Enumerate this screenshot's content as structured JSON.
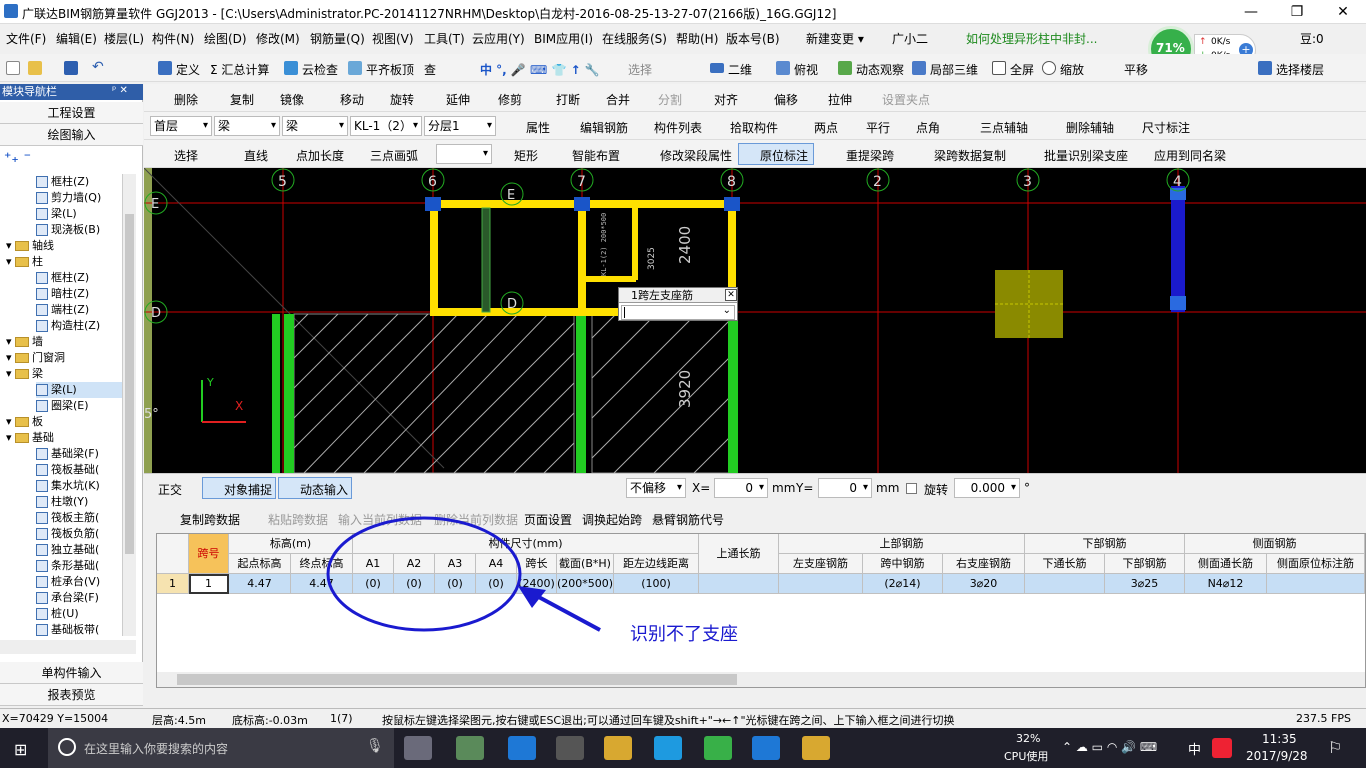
{
  "window": {
    "title": "广联达BIM钢筋算量软件 GGJ2013 - [C:\\Users\\Administrator.PC-20141127NRHM\\Desktop\\白龙村-2016-08-25-13-27-07(2166版)_16G.GGJ12]",
    "minimize": "—",
    "restore": "❐",
    "close": "✕"
  },
  "menu": [
    "文件(F)",
    "编辑(E)",
    "楼层(L)",
    "构件(N)",
    "绘图(D)",
    "修改(M)",
    "钢筋量(Q)",
    "视图(V)",
    "工具(T)",
    "云应用(Y)",
    "BIM应用(I)",
    "在线服务(S)",
    "帮助(H)",
    "版本号(B)",
    "新建变更 ▾",
    "广小二",
    "如何处理异形柱中非封...",
    "豆:0"
  ],
  "net": {
    "percent": "71%",
    "up": "0K/s",
    "down": "0K/s"
  },
  "toolbar1": [
    "定义",
    "Σ 汇总计算",
    "云检查",
    "平齐板顶",
    "查",
    "选择",
    "二维",
    "俯视",
    "动态观察",
    "局部三维",
    "全屏",
    "缩放",
    "平移",
    "",
    "选择楼层"
  ],
  "toolbar2": [
    "删除",
    "复制",
    "镜像",
    "移动",
    "旋转",
    "延伸",
    "修剪",
    "打断",
    "合并",
    "分割",
    "对齐",
    "偏移",
    "拉伸",
    "设置夹点"
  ],
  "toolbar3": {
    "floor": "首层",
    "type1": "梁",
    "type2": "梁",
    "name": "KL-1（2）",
    "layer": "分层1",
    "items": [
      "属性",
      "编辑钢筋",
      "构件列表",
      "拾取构件",
      "两点",
      "平行",
      "点角",
      "三点辅轴",
      "删除辅轴",
      "尺寸标注"
    ]
  },
  "toolbar4": [
    "选择",
    "直线",
    "点加长度",
    "三点画弧",
    "矩形",
    "智能布置",
    "修改梁段属性",
    "原位标注",
    "重提梁跨",
    "梁跨数据复制",
    "批量识别梁支座",
    "应用到同名梁"
  ],
  "sidebar": {
    "header": "模块导航栏",
    "pin": "ᵖ ✕",
    "tabs": [
      "工程设置",
      "绘图输入"
    ],
    "bottom_tabs": [
      "单构件输入",
      "报表预览"
    ],
    "items": [
      {
        "t": "框柱(Z)",
        "lvl": 3,
        "k": "c"
      },
      {
        "t": "剪力墙(Q)",
        "lvl": 3,
        "k": "c"
      },
      {
        "t": "梁(L)",
        "lvl": 3,
        "k": "c"
      },
      {
        "t": "现浇板(B)",
        "lvl": 3,
        "k": "c"
      },
      {
        "t": "轴线",
        "lvl": 1,
        "k": "f"
      },
      {
        "t": "柱",
        "lvl": 1,
        "k": "f"
      },
      {
        "t": "框柱(Z)",
        "lvl": 3,
        "k": "c"
      },
      {
        "t": "暗柱(Z)",
        "lvl": 3,
        "k": "c"
      },
      {
        "t": "端柱(Z)",
        "lvl": 3,
        "k": "c"
      },
      {
        "t": "构造柱(Z)",
        "lvl": 3,
        "k": "c"
      },
      {
        "t": "墙",
        "lvl": 1,
        "k": "f"
      },
      {
        "t": "门窗洞",
        "lvl": 1,
        "k": "f"
      },
      {
        "t": "梁",
        "lvl": 1,
        "k": "f"
      },
      {
        "t": "梁(L)",
        "lvl": 3,
        "k": "c"
      },
      {
        "t": "圈梁(E)",
        "lvl": 3,
        "k": "c"
      },
      {
        "t": "板",
        "lvl": 1,
        "k": "f"
      },
      {
        "t": "基础",
        "lvl": 1,
        "k": "f"
      },
      {
        "t": "基础梁(F)",
        "lvl": 3,
        "k": "c"
      },
      {
        "t": "筏板基础(",
        "lvl": 3,
        "k": "c"
      },
      {
        "t": "集水坑(K)",
        "lvl": 3,
        "k": "c"
      },
      {
        "t": "柱墩(Y)",
        "lvl": 3,
        "k": "c"
      },
      {
        "t": "筏板主筋(",
        "lvl": 3,
        "k": "c"
      },
      {
        "t": "筏板负筋(",
        "lvl": 3,
        "k": "c"
      },
      {
        "t": "独立基础(",
        "lvl": 3,
        "k": "c"
      },
      {
        "t": "条形基础(",
        "lvl": 3,
        "k": "c"
      },
      {
        "t": "桩承台(V)",
        "lvl": 3,
        "k": "c"
      },
      {
        "t": "承台梁(F)",
        "lvl": 3,
        "k": "c"
      },
      {
        "t": "桩(U)",
        "lvl": 3,
        "k": "c"
      },
      {
        "t": "基础板带(",
        "lvl": 3,
        "k": "c"
      }
    ]
  },
  "canvas": {
    "axes_top": [
      "5",
      "6",
      "7",
      "8",
      "2",
      "3",
      "4"
    ],
    "axes_left": [
      "E",
      "D"
    ],
    "axis_labels": [
      "E",
      "D"
    ],
    "dims": [
      "2400",
      "3920",
      "3025"
    ],
    "popup_title": "1跨左支座筋",
    "ucs_y": "Y",
    "ucs_x": "X",
    "edge_char": "5°"
  },
  "statusbar1": {
    "ortho": "正交",
    "snap": "对象捕捉",
    "dyn": "动态输入",
    "offset": "不偏移",
    "x_label": "X=",
    "x_val": "0",
    "mm1": "mm",
    "y_label": "Y=",
    "y_val": "0",
    "mm2": "mm",
    "rotate": "旋转",
    "rot_val": "0.000",
    "deg": "°"
  },
  "gridtb": [
    "复制跨数据",
    "粘贴跨数据",
    "输入当前列数据",
    "删除当前列数据",
    "页面设置",
    "调换起始跨",
    "悬臂钢筋代号"
  ],
  "grid": {
    "group_headers": [
      "标高(m)",
      "构件尺寸(mm)",
      "上通长筋",
      "上部钢筋",
      "下部钢筋",
      "侧面钢筋"
    ],
    "headers": [
      "跨号",
      "起点标高",
      "终点标高",
      "A1",
      "A2",
      "A3",
      "A4",
      "跨长",
      "截面(B*H)",
      "距左边线距离",
      "",
      "左支座钢筋",
      "跨中钢筋",
      "右支座钢筋",
      "下通长筋",
      "下部钢筋",
      "侧面通长筋",
      "侧面原位标注筋"
    ],
    "row": {
      "n": "1",
      "cells": [
        "1",
        "4.47",
        "4.47",
        "(0)",
        "(0)",
        "(0)",
        "(0)",
        "(2400)",
        "(200*500)",
        "(100)",
        "",
        "",
        "(2⌀14)",
        "3⌀20",
        "",
        "3⌀25",
        "N4⌀12",
        ""
      ]
    }
  },
  "annotation": "识别不了支座",
  "statusbar2": {
    "coords": "X=70429 Y=15004",
    "floor_h": "层高:4.5m",
    "bottom_h": "底标高:-0.03m",
    "count": "1(7)",
    "hint": "按鼠标左键选择梁图元,按右键或ESC退出;可以通过回车键及shift+\"→←↑\"光标键在跨之间、上下输入框之间进行切换",
    "fps": "237.5 FPS"
  },
  "taskbar": {
    "search": "在这里输入你要搜索的内容",
    "cpu_pct": "32%",
    "cpu_label": "CPU使用",
    "ime": "中",
    "time": "11:35",
    "date": "2017/9/28",
    "notify": "⚐"
  },
  "colors": {
    "accent": "#2f5ea8",
    "annot": "#1a1acf",
    "beam": "#ffe000",
    "selrow": "#c6def5"
  }
}
